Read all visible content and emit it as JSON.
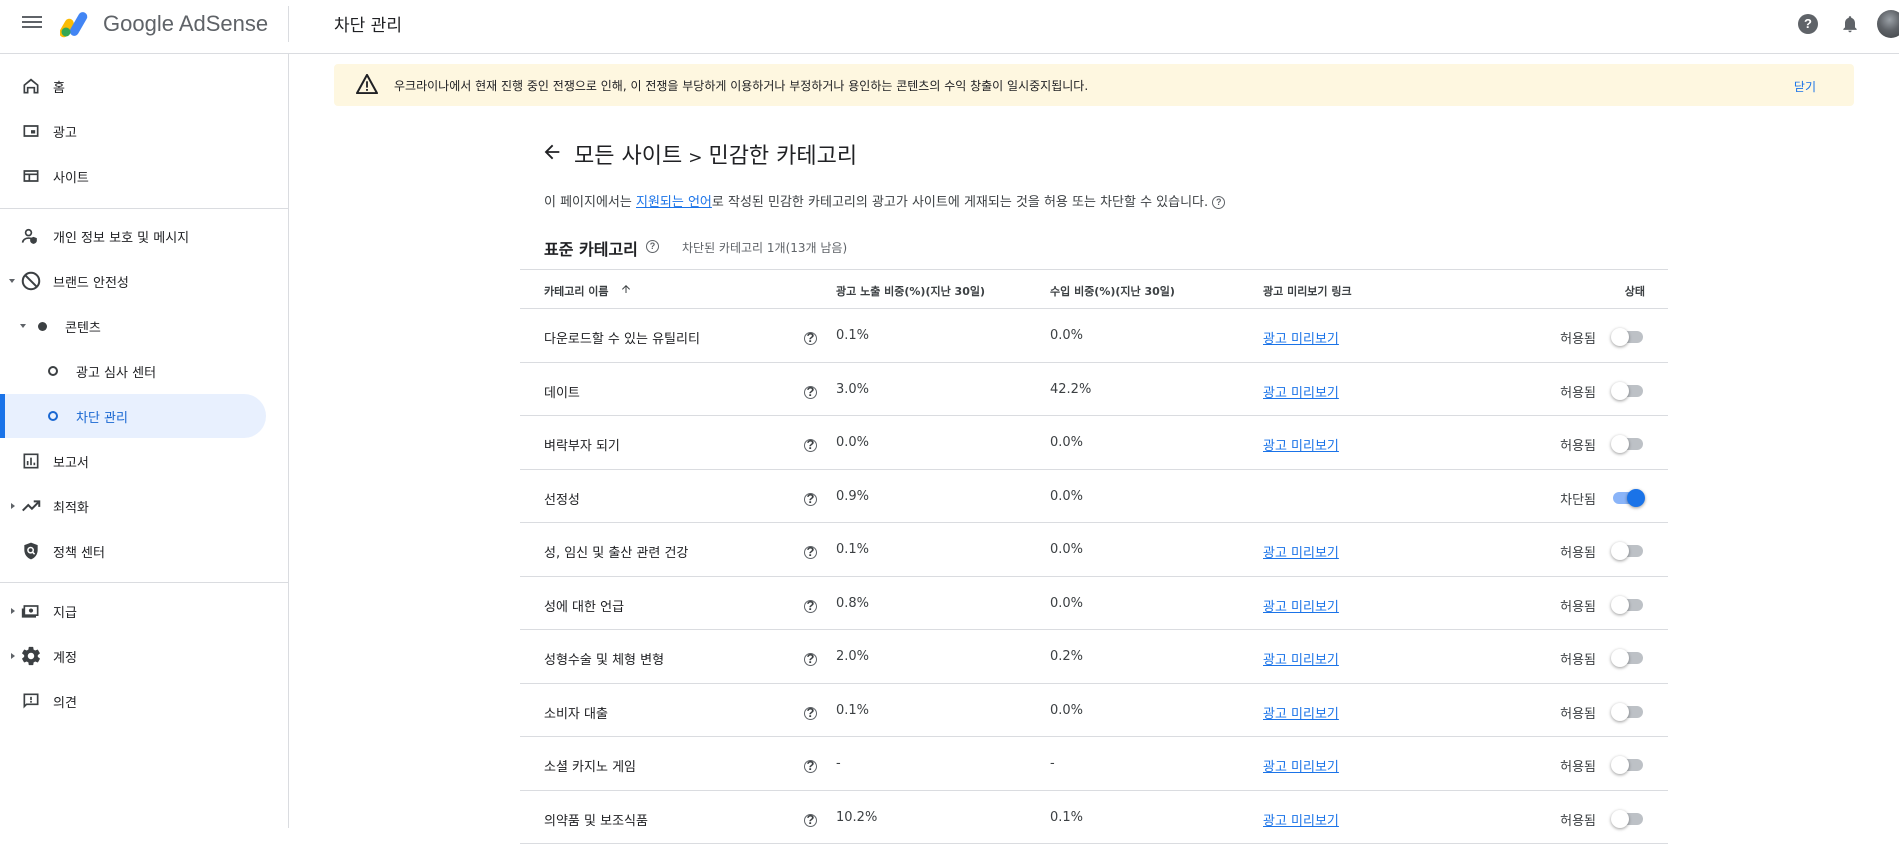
{
  "app": {
    "name": "Google AdSense",
    "page_title": "차단 관리"
  },
  "sidebar": {
    "items": [
      {
        "label": "홈",
        "icon": "home-icon"
      },
      {
        "label": "광고",
        "icon": "ads-icon"
      },
      {
        "label": "사이트",
        "icon": "sites-icon"
      },
      {
        "label": "개인 정보 보호 및 메시지",
        "icon": "privacy-messaging-icon"
      },
      {
        "label": "브랜드 안전성",
        "icon": "block-icon"
      },
      {
        "label": "콘텐츠",
        "icon": "dot-icon"
      },
      {
        "label": "광고 심사 센터",
        "icon": "circle-icon"
      },
      {
        "label": "차단 관리",
        "icon": "circle-icon"
      },
      {
        "label": "보고서",
        "icon": "reports-icon"
      },
      {
        "label": "최적화",
        "icon": "trending-up-icon"
      },
      {
        "label": "정책 센터",
        "icon": "policy-shield-icon"
      },
      {
        "label": "지급",
        "icon": "payments-icon"
      },
      {
        "label": "계정",
        "icon": "gear-icon"
      },
      {
        "label": "의견",
        "icon": "feedback-icon"
      }
    ]
  },
  "banner": {
    "message": "우크라이나에서 현재 진행 중인 전쟁으로 인해, 이 전쟁을 부당하게 이용하거나 부정하거나 용인하는 콘텐츠의 수익 창출이 일시중지됩니다.",
    "close_label": "닫기"
  },
  "breadcrumb": {
    "parent": "모든 사이트",
    "separator": ">",
    "current": "민감한 카테고리"
  },
  "description": {
    "before": "이 페이지에서는 ",
    "link": "지원되는 언어",
    "after": "로 작성된 민감한 카테고리의 광고가 사이트에 게재되는 것을 허용 또는 차단할 수 있습니다."
  },
  "section": {
    "title": "표준 카테고리",
    "subtitle": "차단된 카테고리 1개(13개 남음)"
  },
  "table": {
    "headers": {
      "name": "카테고리 이름",
      "impressions": "광고 노출 비중(%)(지난 30일)",
      "revenue": "수입 비중(%)(지난 30일)",
      "preview": "광고 미리보기 링크",
      "status": "상태"
    },
    "rows": [
      {
        "name": "다운로드할 수 있는 유틸리티",
        "impressions": "0.1%",
        "revenue": "0.0%",
        "preview": "광고 미리보기",
        "status": "허용됨",
        "blocked": false
      },
      {
        "name": "데이트",
        "impressions": "3.0%",
        "revenue": "42.2%",
        "preview": "광고 미리보기",
        "status": "허용됨",
        "blocked": false
      },
      {
        "name": "벼락부자 되기",
        "impressions": "0.0%",
        "revenue": "0.0%",
        "preview": "광고 미리보기",
        "status": "허용됨",
        "blocked": false
      },
      {
        "name": "선정성",
        "impressions": "0.9%",
        "revenue": "0.0%",
        "preview": "",
        "status": "차단됨",
        "blocked": true
      },
      {
        "name": "성, 임신 및 출산 관련 건강",
        "impressions": "0.1%",
        "revenue": "0.0%",
        "preview": "광고 미리보기",
        "status": "허용됨",
        "blocked": false
      },
      {
        "name": "성에 대한 언급",
        "impressions": "0.8%",
        "revenue": "0.0%",
        "preview": "광고 미리보기",
        "status": "허용됨",
        "blocked": false
      },
      {
        "name": "성형수술 및 체형 변형",
        "impressions": "2.0%",
        "revenue": "0.2%",
        "preview": "광고 미리보기",
        "status": "허용됨",
        "blocked": false
      },
      {
        "name": "소비자 대출",
        "impressions": "0.1%",
        "revenue": "0.0%",
        "preview": "광고 미리보기",
        "status": "허용됨",
        "blocked": false
      },
      {
        "name": "소셜 카지노 게임",
        "impressions": "-",
        "revenue": "-",
        "preview": "광고 미리보기",
        "status": "허용됨",
        "blocked": false
      },
      {
        "name": "의약품 및 보조식품",
        "impressions": "10.2%",
        "revenue": "0.1%",
        "preview": "광고 미리보기",
        "status": "허용됨",
        "blocked": false
      }
    ]
  },
  "colors": {
    "accent": "#1a73e8",
    "active_nav_bg": "#e8f0fe",
    "banner_bg": "#fef7e0",
    "toggle_on": "#1a73e8"
  }
}
